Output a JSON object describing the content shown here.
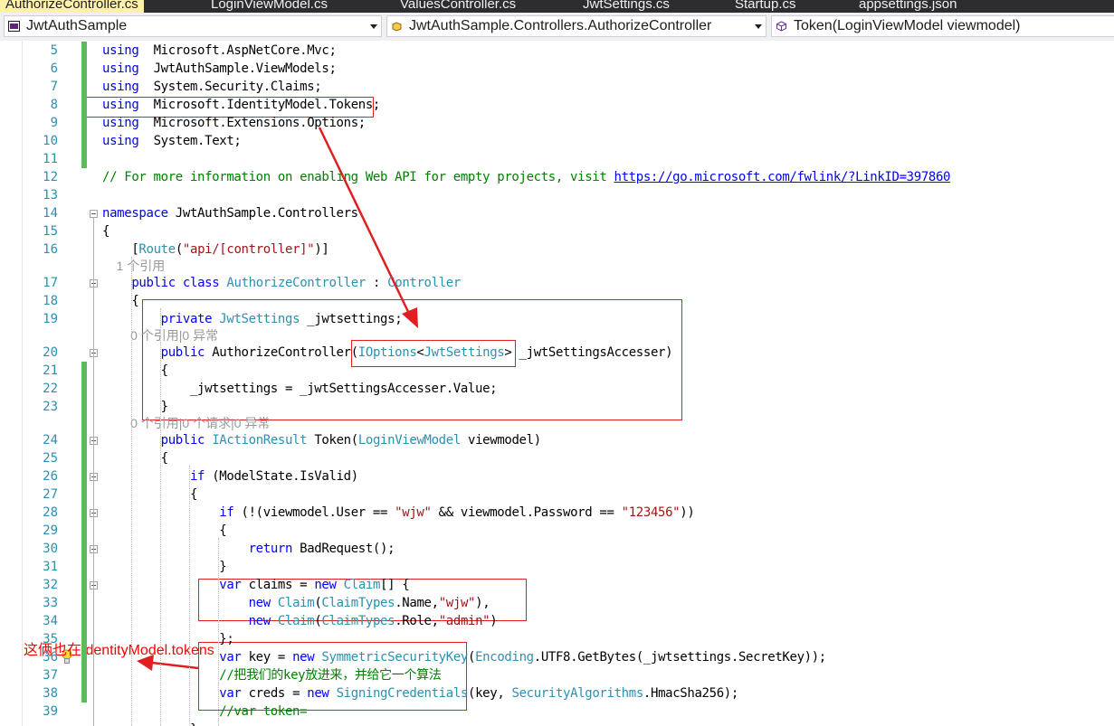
{
  "tabs": [
    {
      "label": "AuthorizeController.cs",
      "active": true
    },
    {
      "label": "LoginViewModel.cs"
    },
    {
      "label": "ValuesController.cs"
    },
    {
      "label": "JwtSettings.cs"
    },
    {
      "label": "Startup.cs"
    },
    {
      "label": "appsettings.json"
    }
  ],
  "nav": {
    "project": "JwtAuthSample",
    "class": "JwtAuthSample.Controllers.AuthorizeController",
    "member": "Token(LoginViewModel viewmodel)"
  },
  "lines": [
    {
      "n": "5",
      "t": [
        [
          "kw",
          "using"
        ],
        [
          "",
          "  Microsoft.AspNetCore.Mvc;"
        ]
      ]
    },
    {
      "n": "6",
      "t": [
        [
          "kw",
          "using"
        ],
        [
          "",
          "  JwtAuthSample.ViewModels;"
        ]
      ]
    },
    {
      "n": "7",
      "t": [
        [
          "kw",
          "using"
        ],
        [
          "",
          "  System.Security.Claims;"
        ]
      ]
    },
    {
      "n": "8",
      "t": [
        [
          "kw",
          "using"
        ],
        [
          "",
          "  Microsoft.IdentityModel.Tokens;"
        ]
      ]
    },
    {
      "n": "9",
      "t": [
        [
          "kw",
          "using"
        ],
        [
          "",
          "  Microsoft.Extensions.Options;"
        ]
      ]
    },
    {
      "n": "10",
      "t": [
        [
          "kw",
          "using"
        ],
        [
          "",
          "  System.Text;"
        ]
      ]
    },
    {
      "n": "11",
      "t": []
    },
    {
      "n": "12",
      "t": [
        [
          "cm",
          "// For more information on enabling Web API for empty projects, visit "
        ],
        [
          "lk",
          "https://go.microsoft.com/fwlink/?LinkID=397860"
        ]
      ]
    },
    {
      "n": "13",
      "t": []
    },
    {
      "n": "14",
      "t": [
        [
          "kw",
          "namespace"
        ],
        [
          "",
          " JwtAuthSample.Controllers"
        ]
      ]
    },
    {
      "n": "15",
      "t": [
        [
          "",
          "{"
        ]
      ]
    },
    {
      "n": "16",
      "t": [
        [
          "",
          "    ["
        ],
        [
          "ty",
          "Route"
        ],
        [
          "",
          "("
        ],
        [
          "st",
          "\"api/[controller]\""
        ],
        [
          "",
          ")]"
        ]
      ]
    },
    {
      "n": "",
      "lens": "    1 个引用"
    },
    {
      "n": "17",
      "t": [
        [
          "",
          "    "
        ],
        [
          "kw",
          "public"
        ],
        [
          "",
          " "
        ],
        [
          "kw",
          "class"
        ],
        [
          "",
          " "
        ],
        [
          "ty",
          "AuthorizeController"
        ],
        [
          "",
          " : "
        ],
        [
          "ty",
          "Controller"
        ]
      ]
    },
    {
      "n": "18",
      "t": [
        [
          "",
          "    {"
        ]
      ]
    },
    {
      "n": "19",
      "t": [
        [
          "",
          "        "
        ],
        [
          "kw",
          "private"
        ],
        [
          "",
          " "
        ],
        [
          "ty",
          "JwtSettings"
        ],
        [
          "",
          " _jwtsettings;"
        ]
      ]
    },
    {
      "n": "",
      "lens": "        0 个引用|0 异常"
    },
    {
      "n": "20",
      "t": [
        [
          "",
          "        "
        ],
        [
          "kw",
          "public"
        ],
        [
          "",
          " AuthorizeController("
        ],
        [
          "ty",
          "IOptions"
        ],
        [
          "",
          "<"
        ],
        [
          "ty",
          "JwtSettings"
        ],
        [
          "",
          "> _jwtSettingsAccesser)"
        ]
      ]
    },
    {
      "n": "21",
      "t": [
        [
          "",
          "        {"
        ]
      ]
    },
    {
      "n": "22",
      "t": [
        [
          "",
          "            _jwtsettings = _jwtSettingsAccesser.Value;"
        ]
      ]
    },
    {
      "n": "23",
      "t": [
        [
          "",
          "        }"
        ]
      ]
    },
    {
      "n": "",
      "lens": "        0 个引用|0 个请求|0 异常"
    },
    {
      "n": "24",
      "t": [
        [
          "",
          "        "
        ],
        [
          "kw",
          "public"
        ],
        [
          "",
          " "
        ],
        [
          "ty",
          "IActionResult"
        ],
        [
          "",
          " Token("
        ],
        [
          "ty",
          "LoginViewModel"
        ],
        [
          "",
          " viewmodel)"
        ]
      ]
    },
    {
      "n": "25",
      "t": [
        [
          "",
          "        {"
        ]
      ]
    },
    {
      "n": "26",
      "t": [
        [
          "",
          "            "
        ],
        [
          "kw",
          "if"
        ],
        [
          "",
          " (ModelState.IsValid)"
        ]
      ]
    },
    {
      "n": "27",
      "t": [
        [
          "",
          "            {"
        ]
      ]
    },
    {
      "n": "28",
      "t": [
        [
          "",
          "                "
        ],
        [
          "kw",
          "if"
        ],
        [
          "",
          " (!(viewmodel.User == "
        ],
        [
          "st",
          "\"wjw\""
        ],
        [
          "",
          " && viewmodel.Password == "
        ],
        [
          "st",
          "\"123456\""
        ],
        [
          "",
          "))"
        ]
      ]
    },
    {
      "n": "29",
      "t": [
        [
          "",
          "                {"
        ]
      ]
    },
    {
      "n": "30",
      "t": [
        [
          "",
          "                    "
        ],
        [
          "kw",
          "return"
        ],
        [
          "",
          " BadRequest();"
        ]
      ]
    },
    {
      "n": "31",
      "t": [
        [
          "",
          "                }"
        ]
      ]
    },
    {
      "n": "32",
      "t": [
        [
          "",
          "                "
        ],
        [
          "kw",
          "var"
        ],
        [
          "",
          " claims = "
        ],
        [
          "kw",
          "new"
        ],
        [
          "",
          " "
        ],
        [
          "ty",
          "Claim"
        ],
        [
          "",
          "[] {"
        ]
      ]
    },
    {
      "n": "33",
      "t": [
        [
          "",
          "                    "
        ],
        [
          "kw",
          "new"
        ],
        [
          "",
          " "
        ],
        [
          "ty",
          "Claim"
        ],
        [
          "",
          "("
        ],
        [
          "ty",
          "ClaimTypes"
        ],
        [
          "",
          ".Name,"
        ],
        [
          "st",
          "\"wjw\""
        ],
        [
          "",
          "),"
        ]
      ]
    },
    {
      "n": "34",
      "t": [
        [
          "",
          "                    "
        ],
        [
          "kw",
          "new"
        ],
        [
          "",
          " "
        ],
        [
          "ty",
          "Claim"
        ],
        [
          "",
          "("
        ],
        [
          "ty",
          "ClaimTypes"
        ],
        [
          "",
          ".Role,"
        ],
        [
          "st",
          "\"admin\""
        ],
        [
          "",
          ")"
        ]
      ]
    },
    {
      "n": "35",
      "t": [
        [
          "",
          "                };"
        ]
      ]
    },
    {
      "n": "36",
      "t": [
        [
          "",
          "                "
        ],
        [
          "kw",
          "var"
        ],
        [
          "",
          " key = "
        ],
        [
          "kw",
          "new"
        ],
        [
          "",
          " "
        ],
        [
          "ty",
          "SymmetricSecurityKey"
        ],
        [
          "",
          "("
        ],
        [
          "ty",
          "Encoding"
        ],
        [
          "",
          ".UTF8.GetBytes(_jwtsettings.SecretKey));"
        ]
      ]
    },
    {
      "n": "37",
      "t": [
        [
          "cm",
          "                //把我们的key放进来，并给它一个算法"
        ]
      ]
    },
    {
      "n": "38",
      "t": [
        [
          "",
          "                "
        ],
        [
          "kw",
          "var"
        ],
        [
          "",
          " creds = "
        ],
        [
          "kw",
          "new"
        ],
        [
          "",
          " "
        ],
        [
          "ty",
          "SigningCredentials"
        ],
        [
          "",
          "(key, "
        ],
        [
          "ty",
          "SecurityAlgorithms"
        ],
        [
          "",
          ".HmacSha256);"
        ]
      ]
    },
    {
      "n": "39",
      "t": [
        [
          "cm",
          "                //var token="
        ]
      ]
    },
    {
      "n": "",
      "t": [
        [
          "",
          "            }"
        ]
      ]
    }
  ],
  "annotation": {
    "text": "这俩也在IdentityModel.tokens",
    "color": "#ff0000"
  },
  "colors": {
    "keyword": "#0000ff",
    "type": "#2b91af",
    "string": "#a31515",
    "comment": "#008000",
    "change_bar": "#57bd57",
    "highlight_box": "#e02020"
  }
}
